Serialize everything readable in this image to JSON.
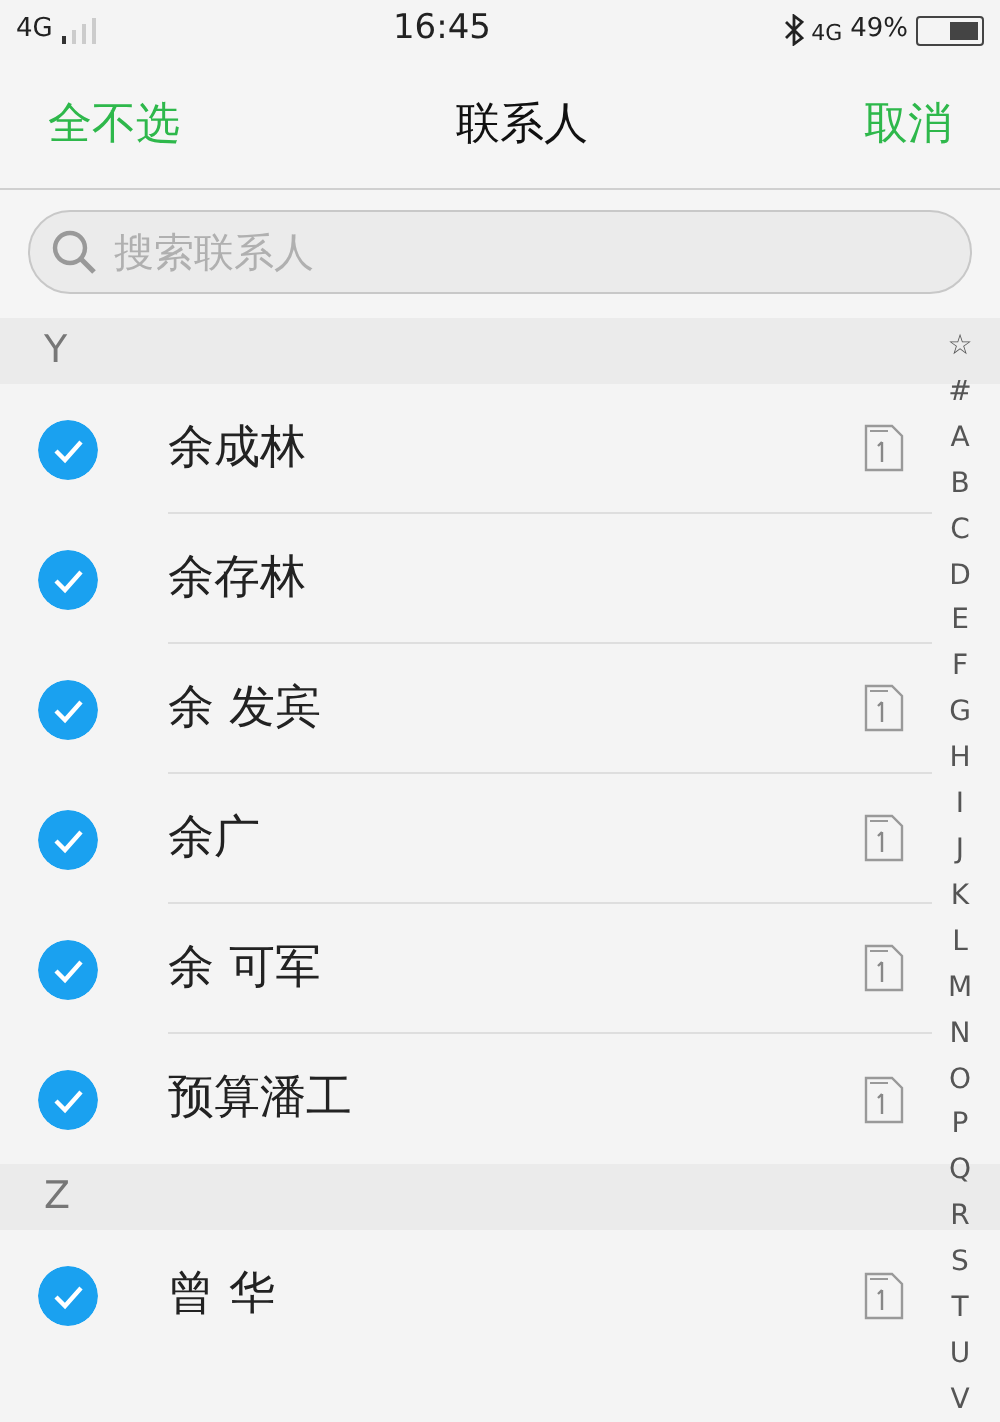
{
  "status_bar": {
    "network": "4G",
    "time": "16:45",
    "data_network": "4G",
    "battery": "49%"
  },
  "header": {
    "left_action": "全不选",
    "title": "联系人",
    "right_action": "取消"
  },
  "search": {
    "placeholder": "搜索联系人"
  },
  "sections": [
    {
      "letter": "Y",
      "contacts": [
        {
          "name": "余成林",
          "checked": true,
          "sim": true
        },
        {
          "name": "余存林",
          "checked": true,
          "sim": false
        },
        {
          "name": "余 发宾",
          "checked": true,
          "sim": true
        },
        {
          "name": "余广",
          "checked": true,
          "sim": true
        },
        {
          "name": "余 可军",
          "checked": true,
          "sim": true
        },
        {
          "name": "预算潘工",
          "checked": true,
          "sim": true
        }
      ]
    },
    {
      "letter": "Z",
      "contacts": [
        {
          "name": "曾 华",
          "checked": true,
          "sim": true
        }
      ]
    }
  ],
  "index": [
    "☆",
    "#",
    "A",
    "B",
    "C",
    "D",
    "E",
    "F",
    "G",
    "H",
    "I",
    "J",
    "K",
    "L",
    "M",
    "N",
    "O",
    "P",
    "Q",
    "R",
    "S",
    "T",
    "U",
    "V"
  ]
}
